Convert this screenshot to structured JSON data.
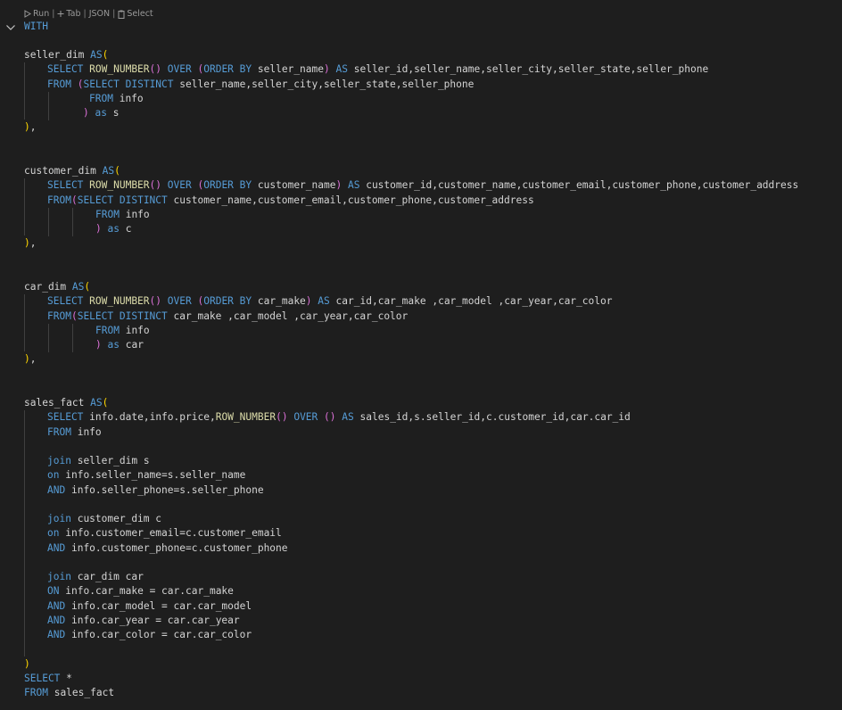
{
  "codelens": {
    "run": "Run",
    "tab": "Tab",
    "json": "JSON",
    "select": "Select"
  },
  "code": {
    "lines": [
      "WITH",
      "seller_dim AS(",
      "SELECT ROW_NUMBER() OVER (ORDER BY seller_name) AS seller_id,seller_name,seller_city,seller_state,seller_phone",
      "FROM (SELECT DISTINCT seller_name,seller_city,seller_state,seller_phone",
      "FROM info",
      ") as s",
      "),",
      "customer_dim AS(",
      "SELECT ROW_NUMBER() OVER (ORDER BY customer_name) AS customer_id,customer_name,customer_email,customer_phone,customer_address",
      "FROM(SELECT DISTINCT customer_name,customer_email,customer_phone,customer_address",
      "FROM info",
      ") as c",
      "),",
      "car_dim AS(",
      "SELECT ROW_NUMBER() OVER (ORDER BY car_make) AS car_id,car_make ,car_model ,car_year,car_color",
      "FROM(SELECT DISTINCT car_make ,car_model ,car_year,car_color",
      "FROM info",
      ") as car",
      "),",
      "sales_fact AS(",
      "SELECT info.date,info.price,ROW_NUMBER() OVER () AS sales_id,s.seller_id,c.customer_id,car.car_id",
      "FROM info",
      "join seller_dim s",
      "on info.seller_name=s.seller_name",
      "AND info.seller_phone=s.seller_phone",
      "join customer_dim c",
      "on info.customer_email=c.customer_email",
      "AND info.customer_phone=c.customer_phone",
      "join car_dim car",
      "ON info.car_make = car.car_make",
      "AND info.car_model = car.car_model",
      "AND info.car_year = car.car_year",
      "AND info.car_color = car.car_color",
      ")",
      "SELECT *",
      "FROM sales_fact"
    ]
  },
  "colors": {
    "background": "#1e1e1e",
    "keyword": "#569cd6",
    "function": "#dcdcaa",
    "text": "#d4d4d4",
    "bracket_level1": "#ffd700",
    "bracket_level2": "#da70d6",
    "bracket_level3": "#179fff"
  },
  "icons": {
    "run": "play-outline-icon",
    "tab": "plus-icon",
    "select": "clipboard-icon",
    "fold": "chevron-down-icon"
  }
}
